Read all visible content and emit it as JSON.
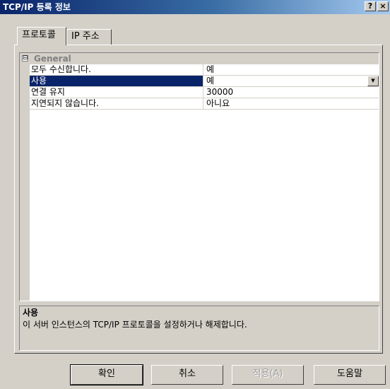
{
  "window": {
    "title": "TCP/IP 등록 정보",
    "help_glyph": "?",
    "close_glyph": "×"
  },
  "tabs": [
    {
      "label": "프로토콜",
      "active": true
    },
    {
      "label": "IP 주소",
      "active": false
    }
  ],
  "property_grid": {
    "category": {
      "toggle": "⊟",
      "label": "General"
    },
    "rows": [
      {
        "name": "모두 수신합니다.",
        "value": "예"
      },
      {
        "name": "사용",
        "value": "예",
        "selected": true
      },
      {
        "name": "연결 유지",
        "value": "30000"
      },
      {
        "name": "지연되지 않습니다.",
        "value": "아니요"
      }
    ],
    "dropdown_glyph": "▼"
  },
  "description": {
    "title": "사용",
    "text": "이 서버 인스턴스의 TCP/IP 프로토콜을 설정하거나 해제합니다."
  },
  "buttons": {
    "ok": "확인",
    "cancel": "취소",
    "apply": "적용(A)",
    "help": "도움말"
  },
  "colors": {
    "title_bar_start": "#0a246a",
    "title_bar_end": "#a6caf0",
    "selection": "#0a246a",
    "face": "#d4d0c8"
  }
}
